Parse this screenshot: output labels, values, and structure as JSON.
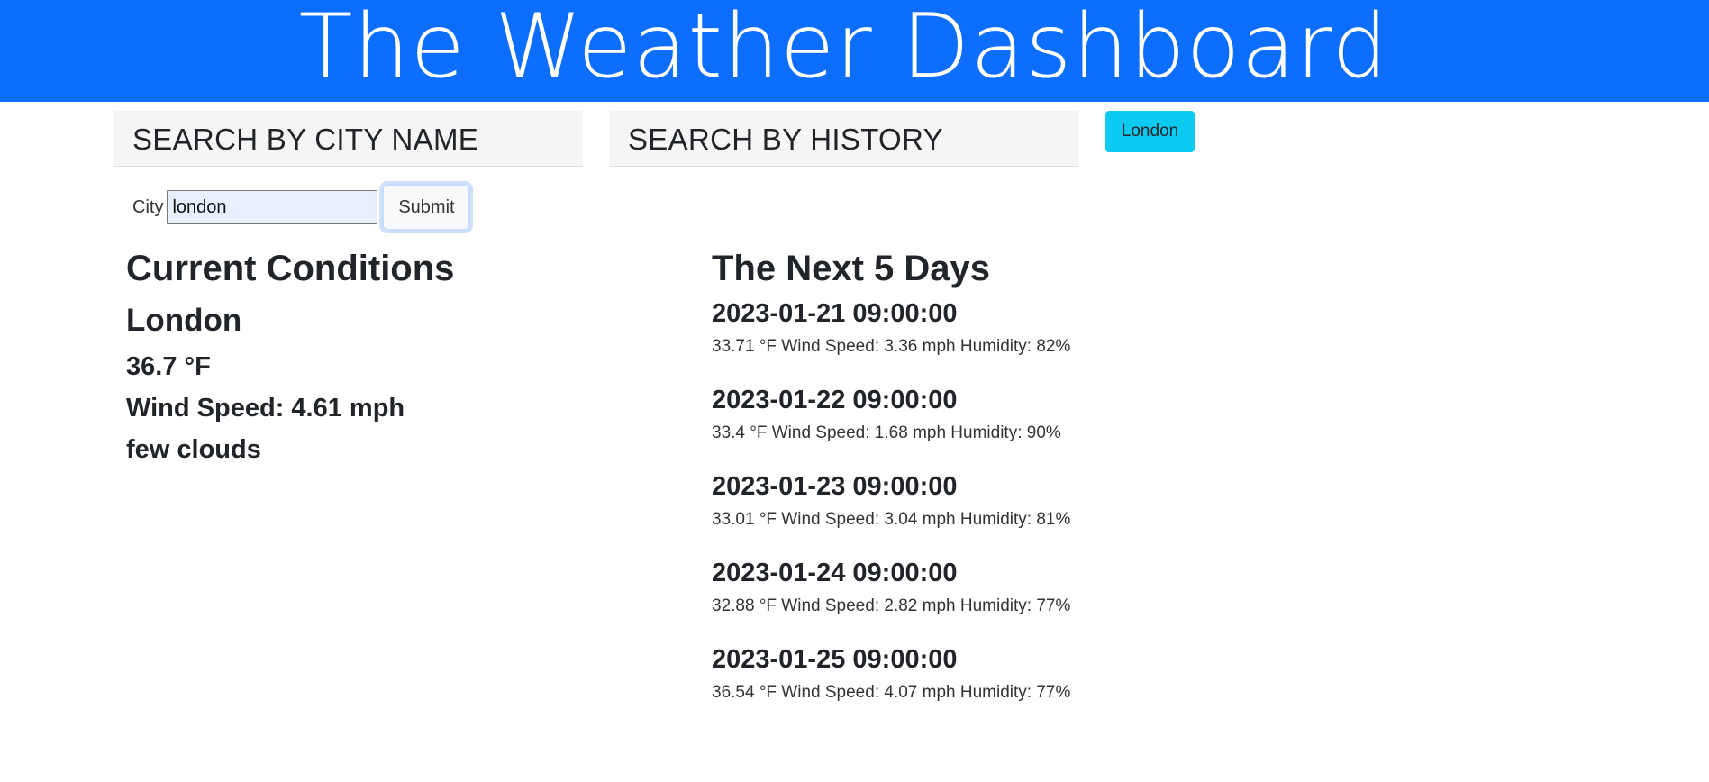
{
  "header": {
    "title": "The Weather Dashboard"
  },
  "search": {
    "heading": "SEARCH BY CITY NAME",
    "city_label": "City",
    "city_value": "london",
    "submit_label": "Submit"
  },
  "history": {
    "heading": "SEARCH BY HISTORY",
    "items": [
      {
        "label": "London"
      }
    ]
  },
  "current": {
    "heading": "Current Conditions",
    "city": "London",
    "temperature": "36.7 °F",
    "wind": "Wind Speed: 4.61 mph",
    "description": "few clouds"
  },
  "forecast": {
    "heading": "The Next 5 Days",
    "days": [
      {
        "datetime": "2023-01-21 09:00:00",
        "details": "33.71 °F Wind Speed: 3.36 mph Humidity: 82%"
      },
      {
        "datetime": "2023-01-22 09:00:00",
        "details": "33.4 °F Wind Speed: 1.68 mph Humidity: 90%"
      },
      {
        "datetime": "2023-01-23 09:00:00",
        "details": "33.01 °F Wind Speed: 3.04 mph Humidity: 81%"
      },
      {
        "datetime": "2023-01-24 09:00:00",
        "details": "32.88 °F Wind Speed: 2.82 mph Humidity: 77%"
      },
      {
        "datetime": "2023-01-25 09:00:00",
        "details": "36.54 °F Wind Speed: 4.07 mph Humidity: 77%"
      }
    ]
  },
  "colors": {
    "banner": "#0d6efd",
    "history_button": "#0dcaf0",
    "panel_bg": "#f5f5f5"
  }
}
